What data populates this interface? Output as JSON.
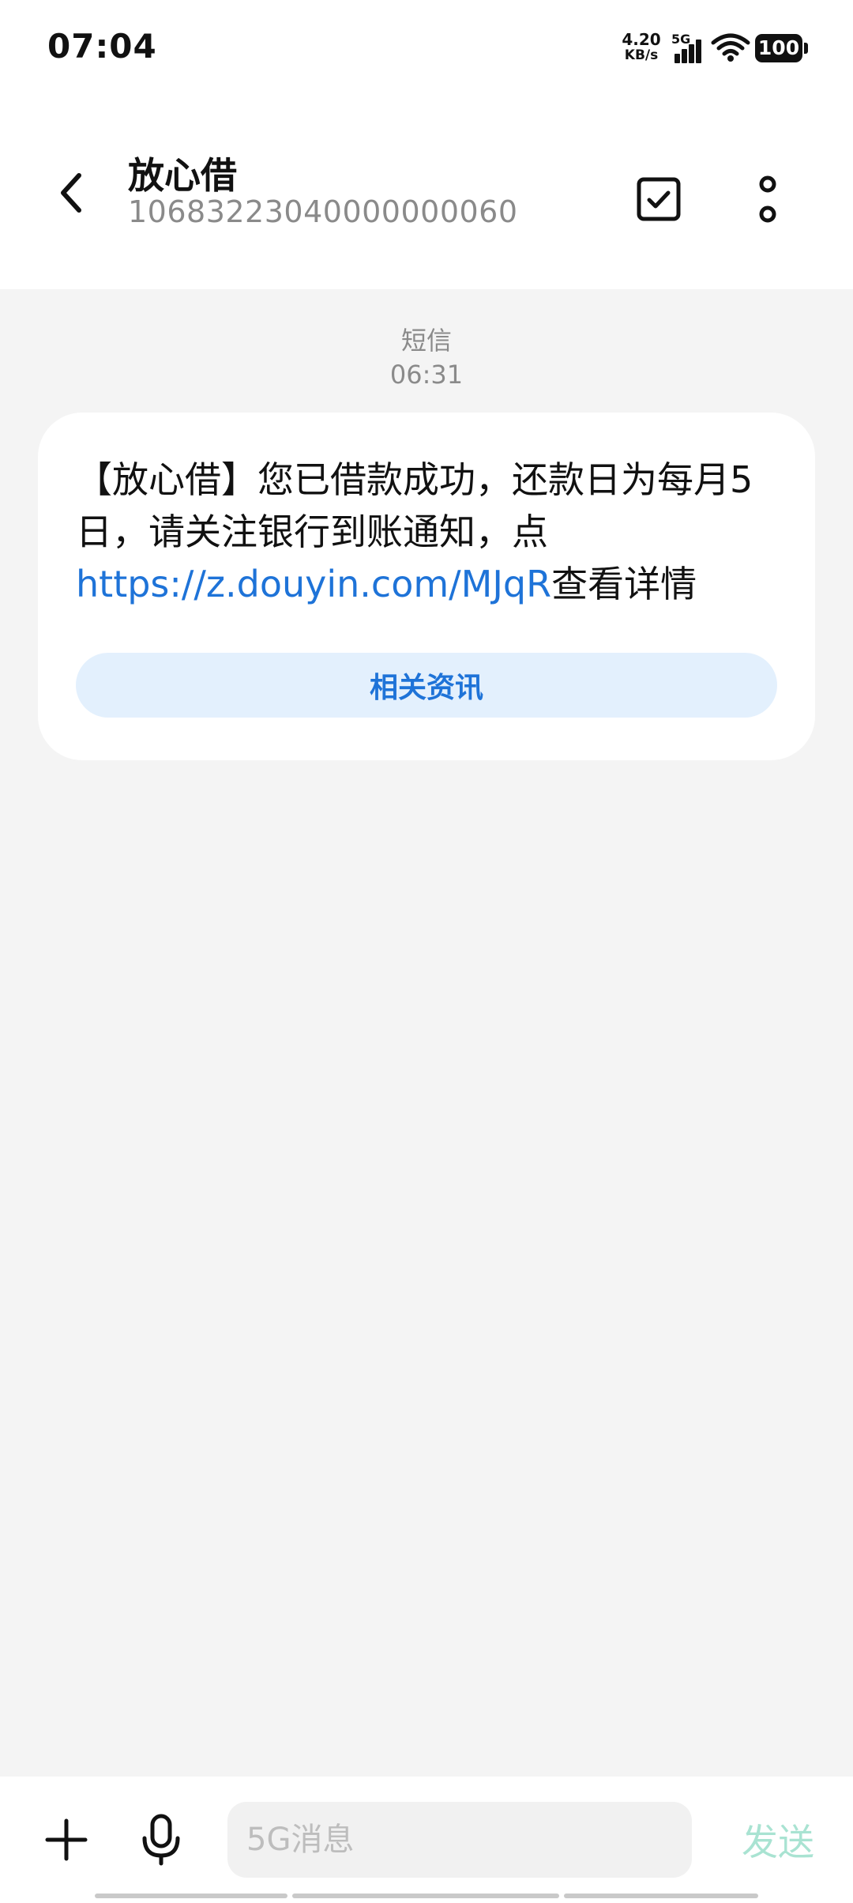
{
  "status_bar": {
    "time": "07:04",
    "net_speed_value": "4.20",
    "net_speed_unit": "KB/s",
    "network_type": "5G",
    "battery": "100"
  },
  "header": {
    "contact_name": "放心借",
    "contact_number": "10683223040000000060",
    "back_icon": "chevron-left-icon",
    "select_icon": "checkbox-icon",
    "more_icon": "more-vertical-icon"
  },
  "conversation": {
    "message_type": "短信",
    "message_time": "06:31",
    "message": {
      "text_before_link": "【放心借】您已借款成功，还款日为每月5日，请关注银行到账通知，点",
      "link": "https://z.douyin.com/MJqR",
      "text_after_link": "查看详情"
    },
    "related_button_label": "相关资讯"
  },
  "composer": {
    "placeholder": "5G消息",
    "send_label": "发送",
    "plus_icon": "plus-icon",
    "mic_icon": "microphone-icon"
  },
  "colors": {
    "link": "#1e73d8",
    "related_button_bg": "#e3f0fd",
    "send_disabled": "#a9e3d2",
    "background": "#f4f4f4"
  }
}
